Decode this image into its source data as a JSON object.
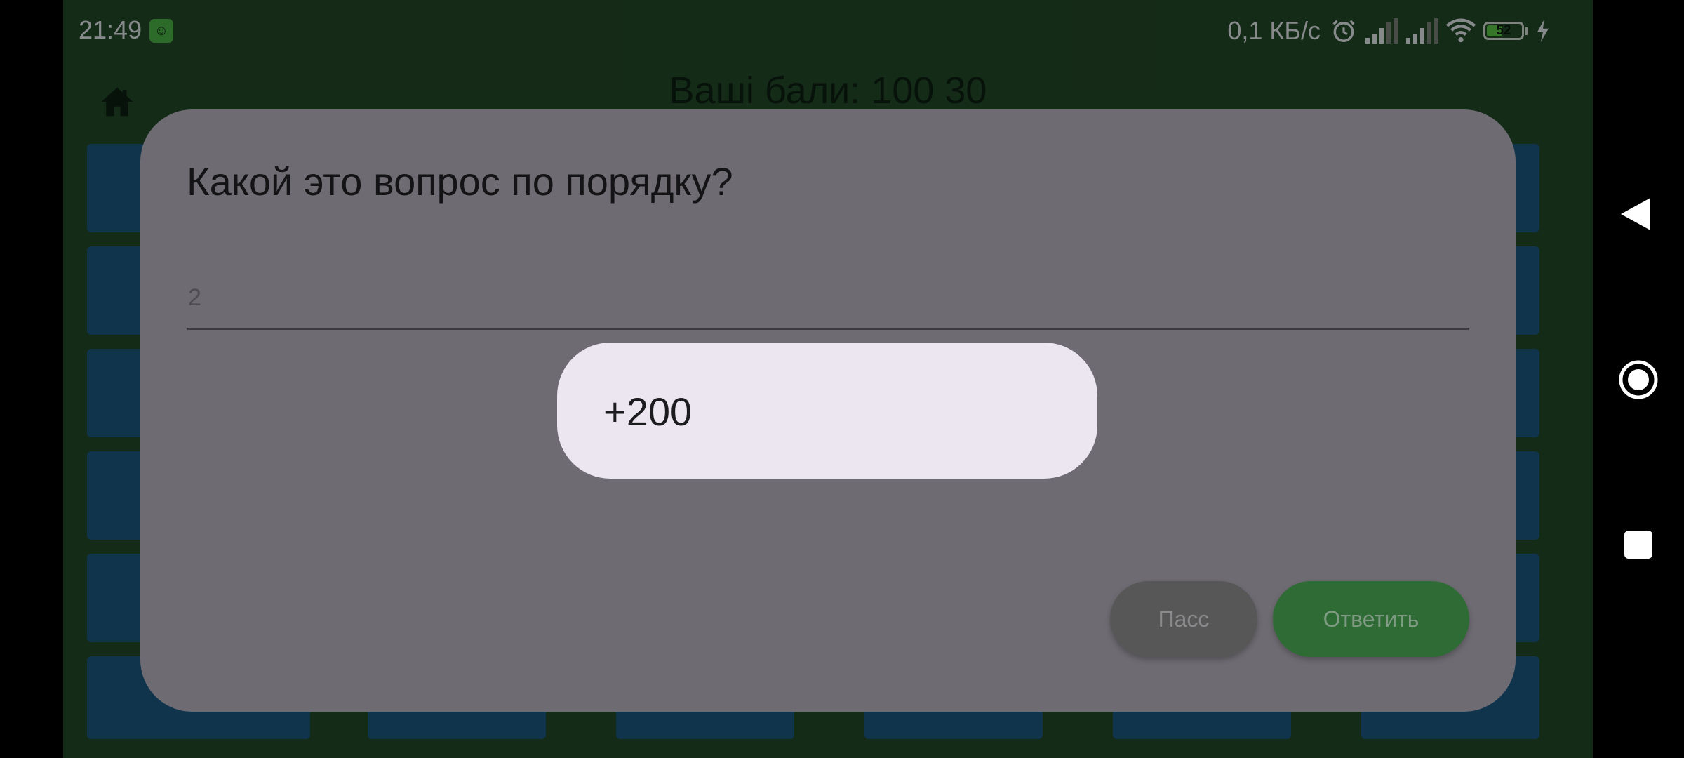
{
  "status_bar": {
    "time": "21:49",
    "app_icon": "cat-face-icon",
    "network_speed": "0,1 КБ/с",
    "icons": [
      "alarm-icon",
      "signal-icon",
      "signal-icon",
      "wifi-icon",
      "battery-icon",
      "charging-bolt-icon"
    ],
    "battery_level": "52"
  },
  "header": {
    "home_icon": "home-icon",
    "score_text": "Ваші бали: 100 30"
  },
  "dialog": {
    "title": "Какой это вопрос по порядку?",
    "answer_placeholder": "2",
    "toast_text": "+200",
    "pass_label": "Пасс",
    "answer_label": "Ответить"
  },
  "nav_bar": {
    "icons": [
      "back-triangle-icon",
      "home-circle-icon",
      "recents-square-icon"
    ]
  },
  "colors": {
    "app_background": "#244a2a",
    "tile": "#1a5a84",
    "dialog": "#6e6c72",
    "toast": "#ece6f0",
    "pass_button": "#575758",
    "answer_button": "#2f6b35"
  }
}
